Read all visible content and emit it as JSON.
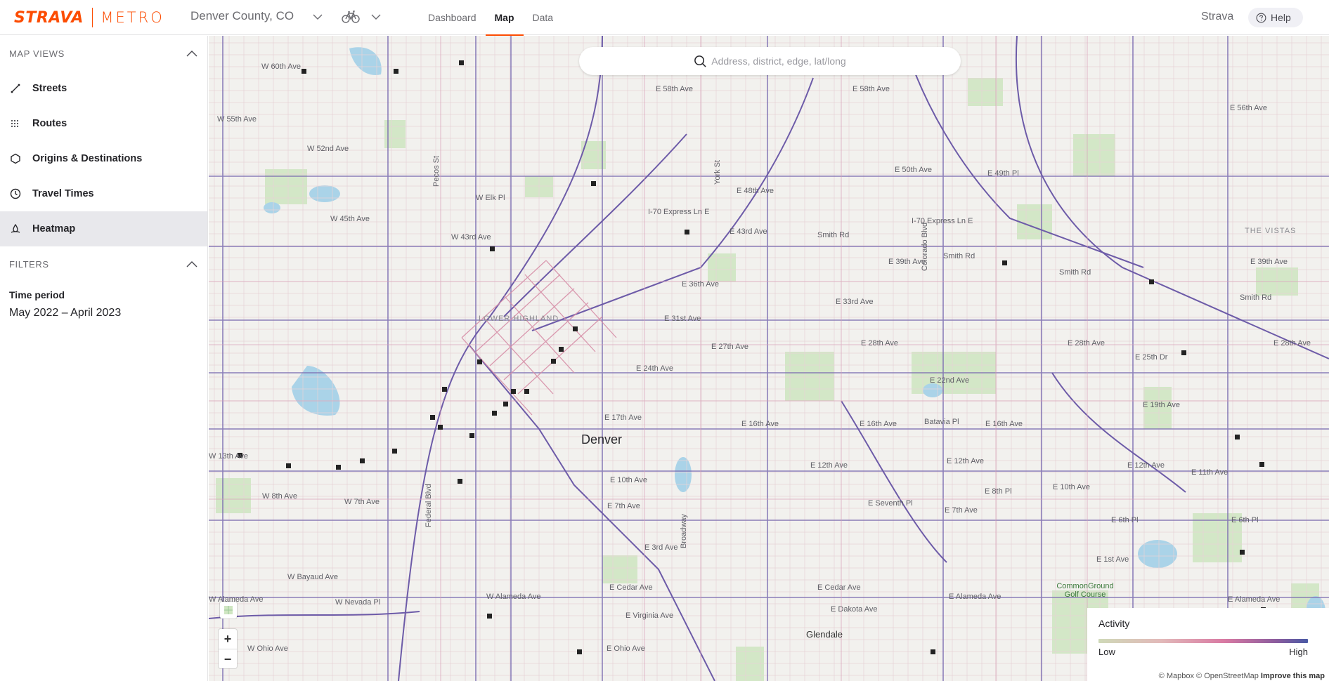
{
  "brand": {
    "name": "STRAVA",
    "product": "METRO"
  },
  "header": {
    "region": "Denver County, CO",
    "activity_icon": "bicycle-icon",
    "tabs": [
      {
        "label": "Dashboard",
        "active": false
      },
      {
        "label": "Map",
        "active": true
      },
      {
        "label": "Data",
        "active": false
      }
    ],
    "account": "Strava",
    "help_label": "Help"
  },
  "sidebar": {
    "map_views_title": "MAP VIEWS",
    "items": [
      {
        "label": "Streets",
        "icon": "line-segment-icon",
        "active": false
      },
      {
        "label": "Routes",
        "icon": "routes-icon",
        "active": false
      },
      {
        "label": "Origins & Destinations",
        "icon": "hexagon-icon",
        "active": false
      },
      {
        "label": "Travel Times",
        "icon": "clock-icon",
        "active": false
      },
      {
        "label": "Heatmap",
        "icon": "heatmap-icon",
        "active": true
      }
    ],
    "filters_title": "FILTERS",
    "time_period_label": "Time period",
    "time_period_value": "May 2022 – April 2023"
  },
  "map": {
    "search_placeholder": "Address, district, edge, lat/long",
    "zoom_in": "+",
    "zoom_out": "−",
    "labels": {
      "denver": "Denver",
      "lower_highland": "LOWER HIGHLAND",
      "the_vistas": "THE VISTAS",
      "glendale": "Glendale",
      "golf": "CommonGround Golf Course",
      "w60": "W 60th Ave",
      "e58_1": "E 58th Ave",
      "e58_2": "E 58th Ave",
      "e56": "E 56th Ave",
      "w55": "W 55th Ave",
      "w52": "W 52nd Ave",
      "e50": "E 50th Ave",
      "e49": "E 49th Pl",
      "e48": "E 48th Ave",
      "welk": "W Elk Pl",
      "i70": "I-70 Express Ln E",
      "i70b": "I-70 Express Ln E",
      "i70c": "I-70 Express Ln E",
      "w45": "W 45th Ave",
      "e43": "E 43rd Ave",
      "w43": "W 43rd Ave",
      "smith1": "Smith Rd",
      "smith2": "Smith Rd",
      "smith3": "Smith Rd",
      "smith4": "Smith Rd",
      "e39a": "E 39th Ave",
      "e39b": "E 39th Ave",
      "e36": "E 36th Ave",
      "e33": "E 33rd Ave",
      "e31": "E 31st Ave",
      "e28a": "E 28th Ave",
      "e28b": "E 28th Ave",
      "e28c": "E 28th Ave",
      "e27": "E 27th Ave",
      "e25": "E 25th Dr",
      "e24": "E 24th Ave",
      "e22": "E 22nd Ave",
      "e19": "E 19th Ave",
      "e17": "E 17th Ave",
      "e16a": "E 16th Ave",
      "e16b": "E 16th Ave",
      "e16c": "E 16th Ave",
      "batavia": "Batavia Pl",
      "e12a": "E 12th Ave",
      "e12b": "E 12th Ave",
      "e12c": "E 12th Ave",
      "e12d": "E 12th Ave",
      "w13": "W 13th Ave",
      "e11": "E 11th Ave",
      "e10a": "E 10th Ave",
      "e10b": "E 10th Ave",
      "w8": "W 8th Ave",
      "w7": "W 7th Ave",
      "e8": "E 8th Pl",
      "e7a": "E 7th Ave",
      "e7b": "E 7th Ave",
      "e7c": "E Seventh Pl",
      "e6a": "E 6th Pl",
      "e6b": "E 6th Pl",
      "e3": "E 3rd Ave",
      "e1": "E 1st Ave",
      "bayaud": "W Bayaud Ave",
      "walameda1": "W Alameda Ave",
      "walameda2": "W Alameda Ave",
      "ealameda1": "E Alameda Ave",
      "ealameda2": "E Alameda Ave",
      "nevada": "W Nevada Pl",
      "cedar1": "E Cedar Ave",
      "cedar2": "E Cedar Ave",
      "dakota": "E Dakota Ave",
      "virginia": "E Virginia Ave",
      "ohio1": "W Ohio Ave",
      "ohio2": "E Ohio Ave",
      "exposition": "E Exposition Ave",
      "pecos": "Pecos St",
      "federal": "Federal Blvd",
      "colorado": "Colorado Blvd",
      "york": "York St",
      "broadway": "Broadway"
    }
  },
  "legend": {
    "title": "Activity",
    "low": "Low",
    "high": "High"
  },
  "attribution": {
    "mapbox": "© Mapbox",
    "osm": "© OpenStreetMap",
    "improve": "Improve this map"
  }
}
